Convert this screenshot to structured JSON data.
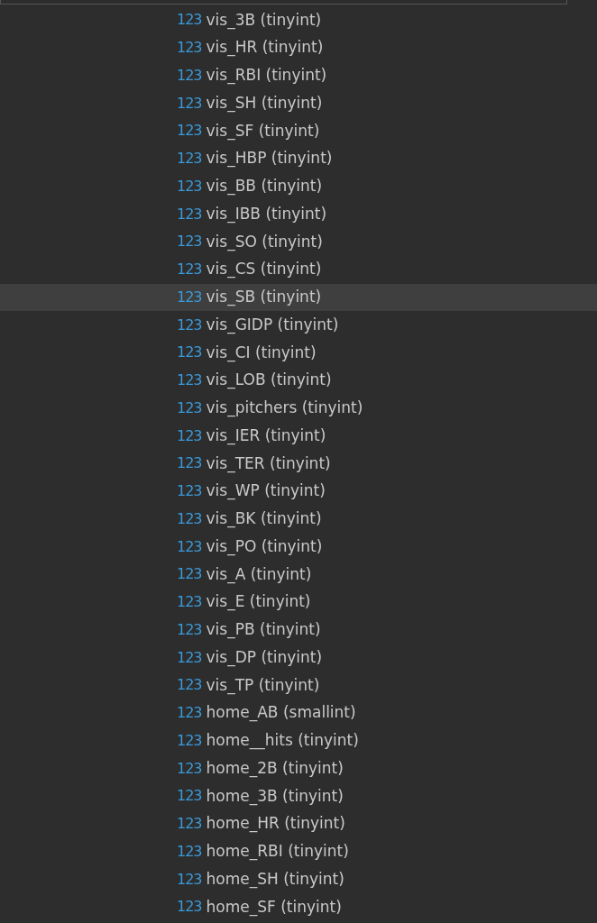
{
  "columns": [
    {
      "type_icon": "123",
      "label": "vis_3B (tinyint)",
      "selected": false
    },
    {
      "type_icon": "123",
      "label": "vis_HR (tinyint)",
      "selected": false
    },
    {
      "type_icon": "123",
      "label": "vis_RBI (tinyint)",
      "selected": false
    },
    {
      "type_icon": "123",
      "label": "vis_SH (tinyint)",
      "selected": false
    },
    {
      "type_icon": "123",
      "label": "vis_SF (tinyint)",
      "selected": false
    },
    {
      "type_icon": "123",
      "label": "vis_HBP (tinyint)",
      "selected": false
    },
    {
      "type_icon": "123",
      "label": "vis_BB (tinyint)",
      "selected": false
    },
    {
      "type_icon": "123",
      "label": "vis_IBB (tinyint)",
      "selected": false
    },
    {
      "type_icon": "123",
      "label": "vis_SO (tinyint)",
      "selected": false
    },
    {
      "type_icon": "123",
      "label": "vis_CS (tinyint)",
      "selected": false
    },
    {
      "type_icon": "123",
      "label": "vis_SB (tinyint)",
      "selected": true
    },
    {
      "type_icon": "123",
      "label": "vis_GIDP (tinyint)",
      "selected": false
    },
    {
      "type_icon": "123",
      "label": "vis_CI (tinyint)",
      "selected": false
    },
    {
      "type_icon": "123",
      "label": "vis_LOB (tinyint)",
      "selected": false
    },
    {
      "type_icon": "123",
      "label": "vis_pitchers (tinyint)",
      "selected": false
    },
    {
      "type_icon": "123",
      "label": "vis_IER (tinyint)",
      "selected": false
    },
    {
      "type_icon": "123",
      "label": "vis_TER (tinyint)",
      "selected": false
    },
    {
      "type_icon": "123",
      "label": "vis_WP (tinyint)",
      "selected": false
    },
    {
      "type_icon": "123",
      "label": "vis_BK (tinyint)",
      "selected": false
    },
    {
      "type_icon": "123",
      "label": "vis_PO (tinyint)",
      "selected": false
    },
    {
      "type_icon": "123",
      "label": "vis_A (tinyint)",
      "selected": false
    },
    {
      "type_icon": "123",
      "label": "vis_E (tinyint)",
      "selected": false
    },
    {
      "type_icon": "123",
      "label": "vis_PB (tinyint)",
      "selected": false
    },
    {
      "type_icon": "123",
      "label": "vis_DP (tinyint)",
      "selected": false
    },
    {
      "type_icon": "123",
      "label": "vis_TP (tinyint)",
      "selected": false
    },
    {
      "type_icon": "123",
      "label": "home_AB (smallint)",
      "selected": false
    },
    {
      "type_icon": "123",
      "label": "home__hits (tinyint)",
      "selected": false
    },
    {
      "type_icon": "123",
      "label": "home_2B (tinyint)",
      "selected": false
    },
    {
      "type_icon": "123",
      "label": "home_3B (tinyint)",
      "selected": false
    },
    {
      "type_icon": "123",
      "label": "home_HR (tinyint)",
      "selected": false
    },
    {
      "type_icon": "123",
      "label": "home_RBI (tinyint)",
      "selected": false
    },
    {
      "type_icon": "123",
      "label": "home_SH (tinyint)",
      "selected": false
    },
    {
      "type_icon": "123",
      "label": "home_SF (tinyint)",
      "selected": false
    }
  ]
}
